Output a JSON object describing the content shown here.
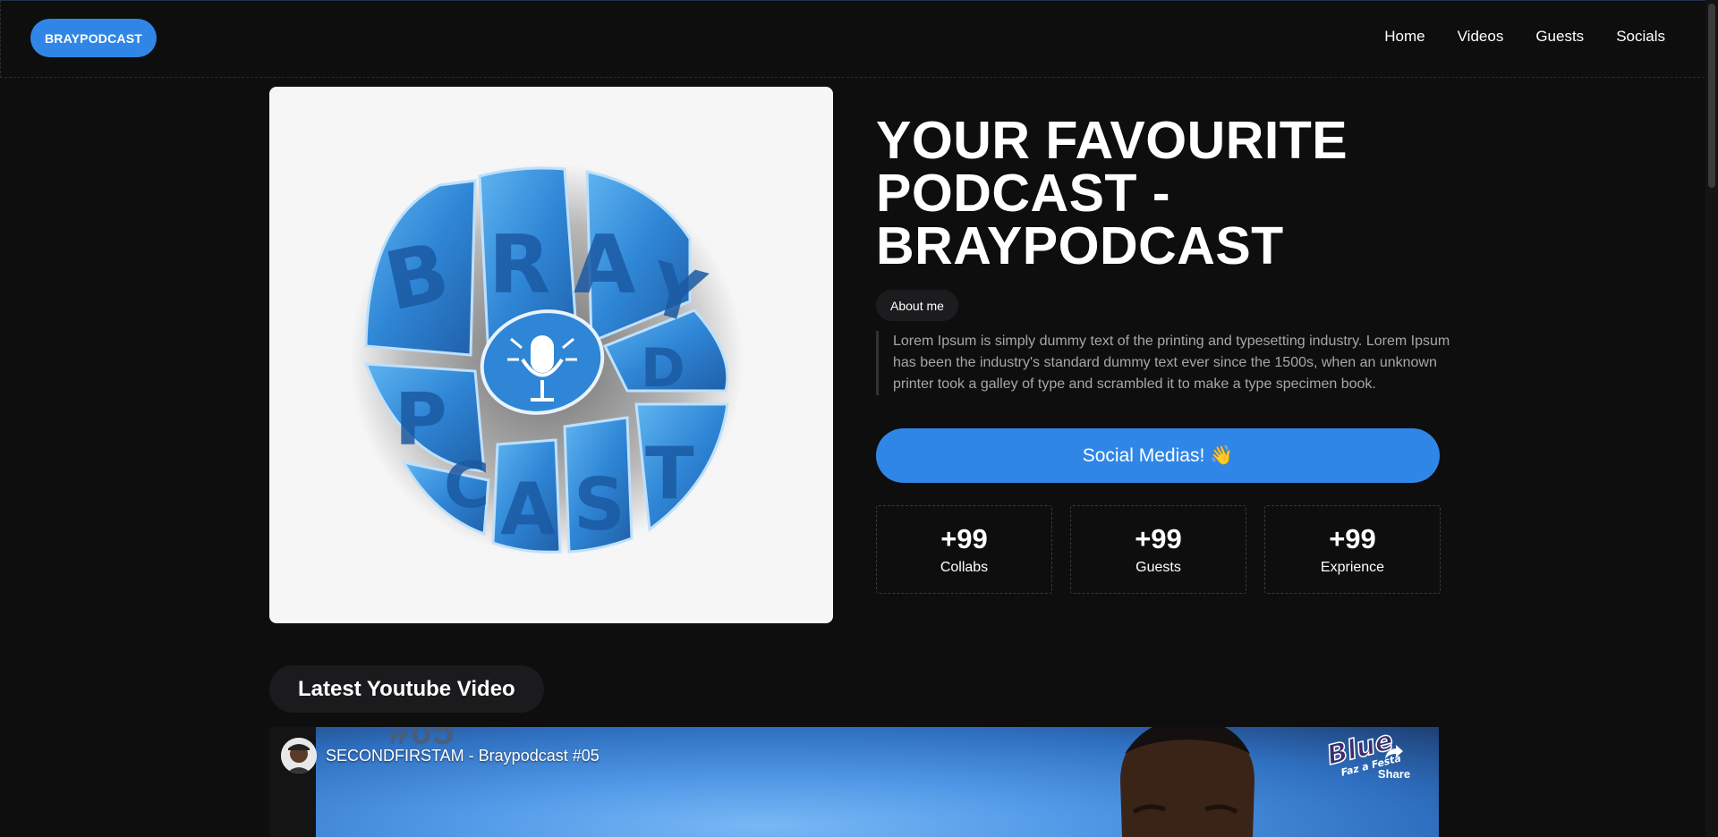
{
  "navbar": {
    "brand": "BRAYPODCAST",
    "links": [
      "Home",
      "Videos",
      "Guests",
      "Socials"
    ]
  },
  "hero": {
    "logo_alt": "BRAYPODCAST logo",
    "title_lines": [
      "YOUR FAVOURITE",
      "PODCAST -",
      "BRAYPODCAST"
    ],
    "about_label": "About me",
    "description": "Lorem Ipsum is simply dummy text of the printing and typesetting industry. Lorem Ipsum has been the industry's standard dummy text ever since the 1500s, when an unknown printer took a galley of type and scrambled it to make a type specimen book.",
    "social_button": "Social Medias! 👋"
  },
  "stats": [
    {
      "value": "+99",
      "label": "Collabs"
    },
    {
      "value": "+99",
      "label": "Guests"
    },
    {
      "value": "+99",
      "label": "Exprience"
    }
  ],
  "latest": {
    "heading": "Latest Youtube Video",
    "video_title": "SECONDFIRSTAM - Braypodcast #05",
    "thumbnail_number": "#05",
    "share_label": "Share",
    "watermark": "Blue Faz a Festa"
  },
  "colors": {
    "accent": "#2f86e6",
    "background": "#0e0e0e",
    "pill": "#1c1c1e"
  },
  "icons": {
    "share": "share-arrow-icon",
    "microphone": "microphone-icon"
  }
}
